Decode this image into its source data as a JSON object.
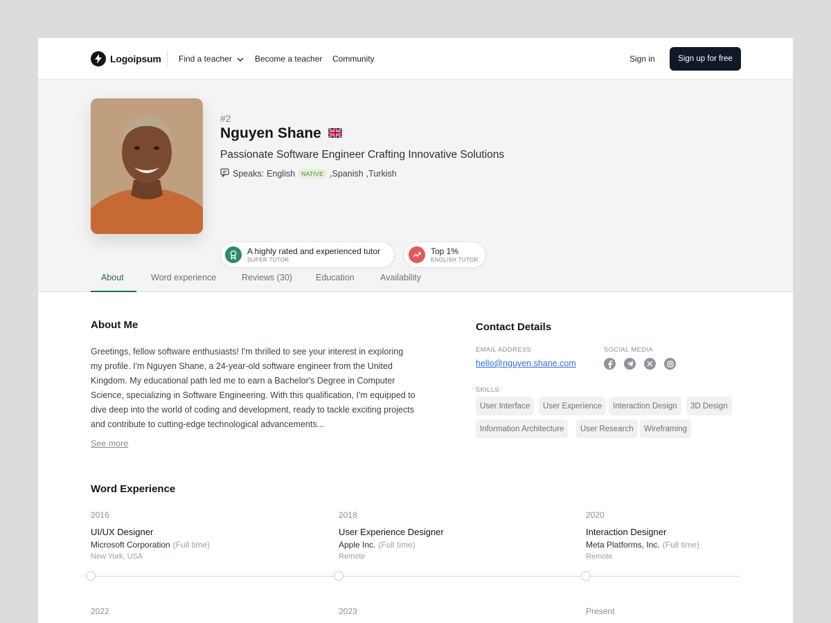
{
  "nav": {
    "logo_text": "Logoipsum",
    "links": [
      "Find a teacher",
      "Become a teacher",
      "Community"
    ],
    "signin": "Sign in",
    "signup": "Sign up for free"
  },
  "profile": {
    "rank": "#2",
    "name": "Nguyen Shane",
    "flag_icon": "uk-flag-icon",
    "headline": "Passionate Software Engineer Crafting Innovative Solutions",
    "speaks_label": "Speaks:",
    "languages": [
      "English",
      ",Spanish",
      ",Turkish"
    ],
    "native_tag": "NATIVE",
    "badges": [
      {
        "title": "A highly rated and experienced tutor",
        "sub": "SUPER TUTOR",
        "color": "#2f8a6a"
      },
      {
        "title": "Top 1%",
        "sub": "ENGLISH TUTOR",
        "color": "#e05a5a"
      }
    ]
  },
  "tabs": [
    "About",
    "Word experience",
    "Reviews (30)",
    "Education",
    "Availability"
  ],
  "about": {
    "title": "About Me",
    "text": "Greetings, fellow software enthusiasts! I'm thrilled to see your interest in exploring my profile. I'm Nguyen Shane, a 24-year-old software engineer from the United Kingdom. My educational path led me to earn a Bachelor's Degree in Computer Science, specializing in Software Engineering. With this qualification, I'm equipped to dive deep into the world of coding and development, ready to tackle exciting projects and contribute to cutting-edge technological advancements...",
    "see_more": "See more"
  },
  "contact": {
    "title": "Contact Details",
    "email_label": "EMAIL ADDRESS",
    "email": "hello@nguyen.shane.com",
    "social_label": "SOCIAL MEDIA",
    "social_icons": [
      "facebook-icon",
      "telegram-icon",
      "x-icon",
      "instagram-icon"
    ],
    "skills_label": "SKILLS",
    "skills": [
      "User Interface",
      "User Experience",
      "Interaction Design",
      "3D Design",
      "Information Architecture",
      "User Research",
      "Wireframing"
    ]
  },
  "work": {
    "title": "Word Experience",
    "items": [
      {
        "year": "2016",
        "role": "UI/UX Designer",
        "company": "Microsoft Corporation",
        "type": "(Full time)",
        "location": "New York, USA"
      },
      {
        "year": "2018",
        "role": "User Experience Designer",
        "company": "Apple Inc.",
        "type": "(Full time)",
        "location": "Remote"
      },
      {
        "year": "2020",
        "role": "Interaction Designer",
        "company": "Meta Platforms, Inc.",
        "type": "(Full time)",
        "location": "Remote"
      }
    ],
    "next_years": [
      "2022",
      "2023",
      "Present"
    ]
  }
}
